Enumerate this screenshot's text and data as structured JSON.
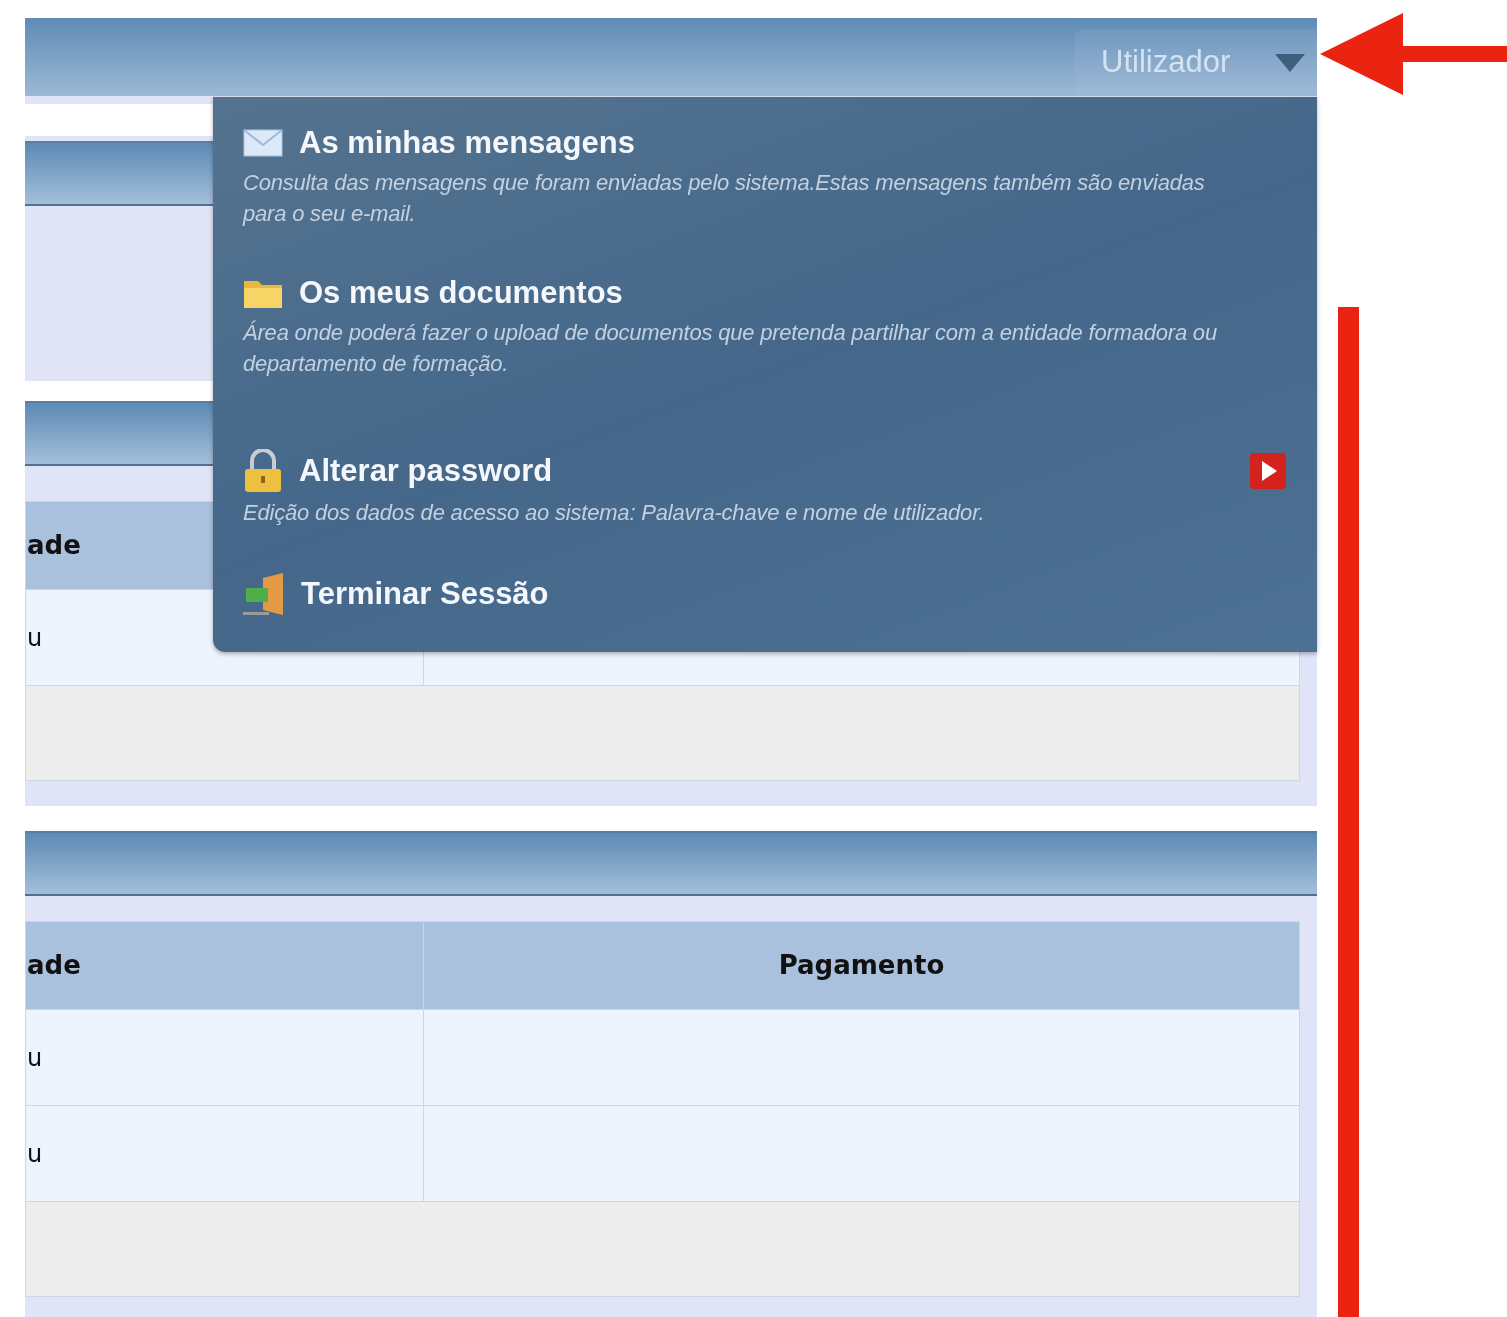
{
  "top_bar": {
    "user_menu": {
      "label": "Utilizador",
      "expanded": true
    }
  },
  "user_dropdown": {
    "items": [
      {
        "kind": "messages",
        "title": "As minhas mensagens",
        "description": "Consulta das mensagens que foram enviadas pelo sistema.Estas mensagens também são enviadas para o seu e-mail.",
        "video": false
      },
      {
        "kind": "documents",
        "title": "Os meus documentos",
        "description": "Área onde poderá fazer o upload de documentos que pretenda partilhar com a entidade formadora ou departamento de formação.",
        "video": false
      },
      {
        "kind": "password",
        "title": "Alterar password",
        "description": "Edição dos dados de acesso ao sistema: Palavra-chave e nome de utilizador.",
        "video": true
      },
      {
        "kind": "logout",
        "title": "Terminar Sessão",
        "video": false
      }
    ]
  },
  "tables": [
    {
      "columns": [
        "ade"
      ],
      "rows": [
        [
          "u"
        ]
      ]
    },
    {
      "columns": [
        "ade",
        "Pagamento"
      ],
      "rows": [
        [
          "u"
        ],
        [
          "u"
        ]
      ]
    }
  ]
}
